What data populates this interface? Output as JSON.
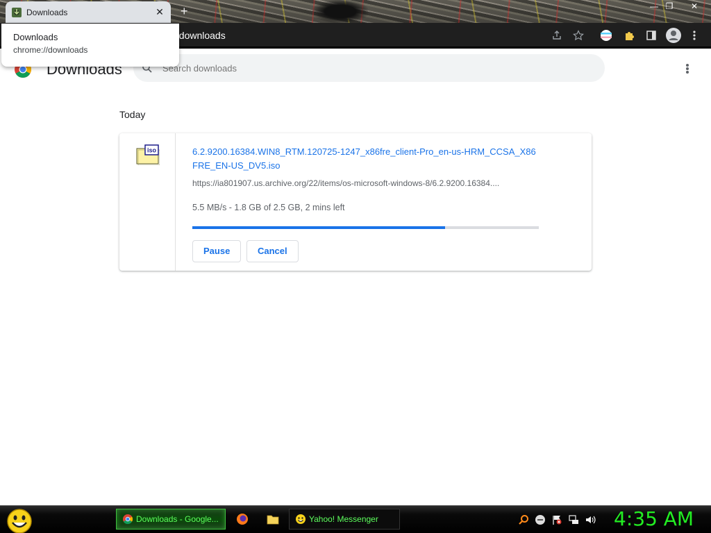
{
  "tab": {
    "title": "Downloads",
    "close_label": "✕",
    "new_tab_label": "+"
  },
  "window_controls": {
    "minimize": "—",
    "maximize": "❐",
    "close": "✕"
  },
  "hovercard": {
    "title": "Downloads",
    "url": "chrome://downloads"
  },
  "omnibox": {
    "text": "//downloads"
  },
  "toolbar_icons": [
    "share-icon",
    "star-icon",
    "flag-icon",
    "extensions-icon",
    "sidebar-icon",
    "profile-icon",
    "menu-icon"
  ],
  "page": {
    "title": "Downloads",
    "search_placeholder": "Search downloads",
    "section_label": "Today"
  },
  "download": {
    "file_name": "6.2.9200.16384.WIN8_RTM.120725-1247_x86fre_client-Pro_en-us-HRM_CCSA_X86FRE_EN-US_DV5.iso",
    "url": "https://ia801907.us.archive.org/22/items/os-microsoft-windows-8/6.2.9200.16384....",
    "status": "5.5 MB/s - 1.8 GB of 2.5 GB, 2 mins left",
    "progress_fraction": 0.73,
    "icon_label": "iso",
    "pause_label": "Pause",
    "cancel_label": "Cancel"
  },
  "taskbar": {
    "tasks": [
      {
        "label": "Downloads - Google...",
        "icon": "chrome-icon",
        "active": true
      },
      {
        "label": "Yahoo! Messenger",
        "icon": "yahoo-smiley-icon",
        "active": false
      }
    ],
    "clock": "4:35 AM"
  },
  "colors": {
    "accent": "#1a73e8",
    "taskbar_text": "#5dff5d",
    "clock": "#22ee22"
  }
}
